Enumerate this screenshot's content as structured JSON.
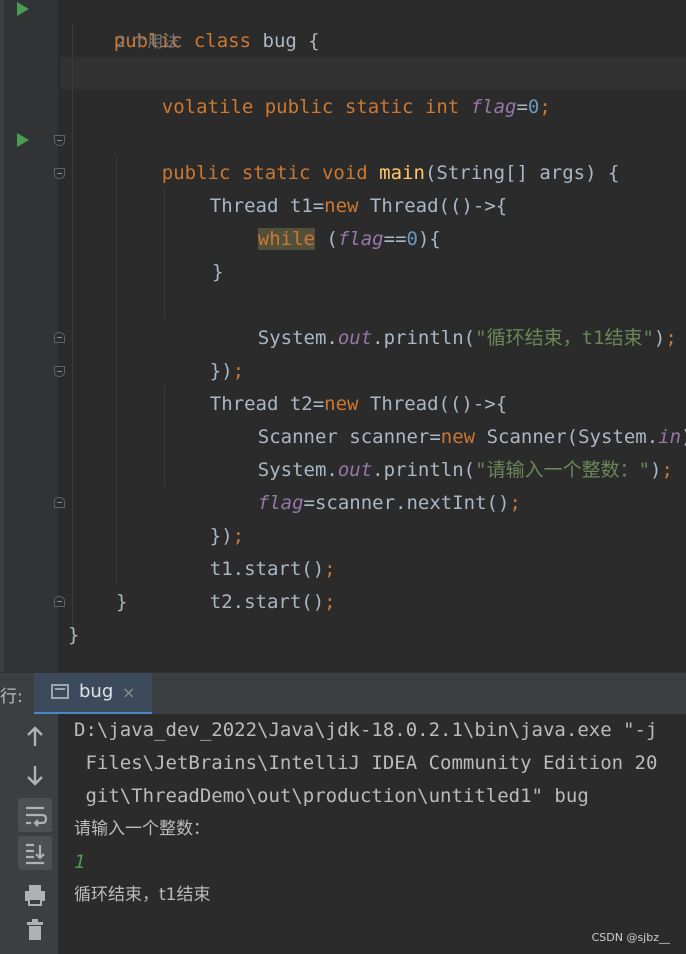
{
  "editor": {
    "class_decl": {
      "kw1": "public",
      "kw2": "class",
      "name": "bug",
      "brace": "{"
    },
    "usage_hint": "2 个用法",
    "field": {
      "kw1": "volatile",
      "kw2": "public",
      "kw3": "static",
      "kw4": "int",
      "name": "flag",
      "eq": "=",
      "value": "0",
      "semi": ";"
    },
    "main_decl": {
      "kw1": "public",
      "kw2": "static",
      "kw3": "void",
      "name": "main",
      "params": "(String[] args) {"
    },
    "t1_decl": {
      "pre": "Thread t1=",
      "kw": "new",
      "post": " Thread(()->{"
    },
    "while_line": {
      "kw": "while",
      "open": " (",
      "var": "flag",
      "eq": "==",
      "num": "0",
      "close": "){"
    },
    "close_brace": "}",
    "print1": {
      "pre": "System.",
      "out": "out",
      "mid": ".println(",
      "str": "\"循环结束，t1结束\"",
      "close": ")",
      "semi": ";"
    },
    "lambda_end": {
      "text": "})",
      "semi": ";"
    },
    "t2_decl": {
      "pre": "Thread t2=",
      "kw": "new",
      "post": " Thread(()->{"
    },
    "scanner_line": {
      "pre": "Scanner scanner=",
      "kw": "new",
      "mid": " Scanner(System.",
      "in": "in",
      "close": ")",
      "semi": ";"
    },
    "print2": {
      "pre": "System.",
      "out": "out",
      "mid": ".println(",
      "str": "\"请输入一个整数：\"",
      "close": ")",
      "semi": ";"
    },
    "assign_line": {
      "var": "flag",
      "rest": "=scanner.nextInt()",
      "semi": ";"
    },
    "start1": {
      "text": "t1.start()",
      "semi": ";"
    },
    "start2": {
      "text": "t2.start()",
      "semi": ";"
    },
    "main_end": "}",
    "class_end": "}"
  },
  "run_panel": {
    "label": "行:",
    "tab_label": "bug",
    "tab_close": "×",
    "tools": [
      "arrow-up-icon",
      "arrow-down-icon",
      "soft-wrap-icon",
      "scroll-to-end-icon",
      "print-icon",
      "trash-icon"
    ]
  },
  "console": {
    "lines": [
      "D:\\java_dev_2022\\Java\\jdk-18.0.2.1\\bin\\java.exe \"-j",
      " Files\\JetBrains\\IntelliJ IDEA Community Edition 20",
      " git\\ThreadDemo\\out\\production\\untitled1\" bug",
      "请输入一个整数：",
      "1",
      "循环结束，t1结束"
    ]
  },
  "watermark": "CSDN @sjbz__",
  "colors": {
    "keyword": "#cc7832",
    "method": "#ffc66d",
    "number": "#6897bb",
    "static_field": "#9876aa",
    "string": "#6a8759",
    "run_green": "#499c54"
  }
}
